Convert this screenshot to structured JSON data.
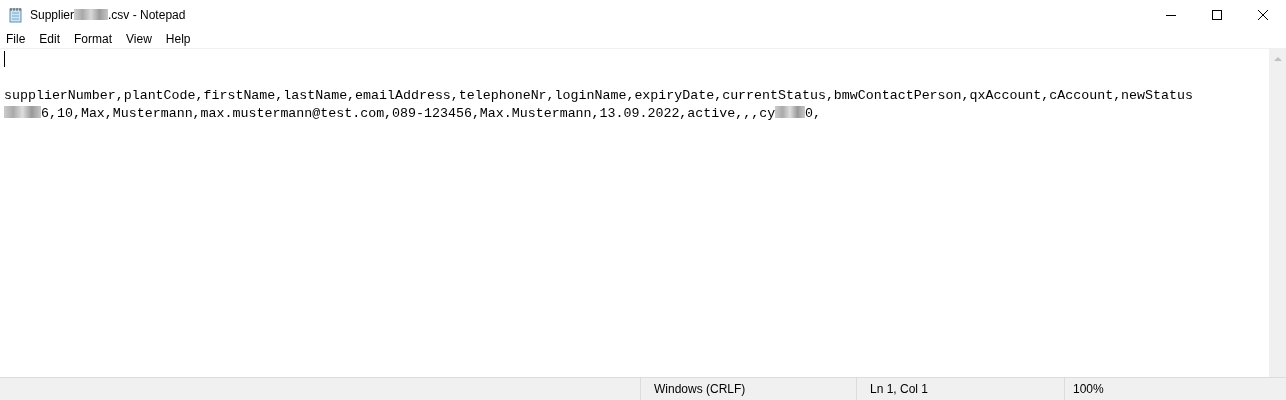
{
  "window": {
    "title": [
      {
        "kind": "text",
        "text": "Supplier"
      },
      {
        "kind": "redacted"
      },
      {
        "kind": "text",
        "text": ".csv - Notepad"
      }
    ]
  },
  "menu": [
    "File",
    "Edit",
    "Format",
    "View",
    "Help"
  ],
  "editor": {
    "lines": [
      [
        {
          "kind": "text",
          "text": "supplierNumber,plantCode,firstName,lastName,emailAddress,telephoneNr,loginName,expiryDate,currentStatus,bmwContactPerson,qxAccount,cAccount,newStatus"
        }
      ],
      [
        {
          "kind": "redacted"
        },
        {
          "kind": "text",
          "text": "6,10,Max,Mustermann,max.mustermann@test.com,089-123456,Max.Mustermann,13.09.2022,active,,,cy"
        },
        {
          "kind": "redacted"
        },
        {
          "kind": "text",
          "text": "0,"
        }
      ]
    ]
  },
  "status_bar": [
    "Windows (CRLF)",
    "Ln 1, Col 1",
    "100%"
  ]
}
